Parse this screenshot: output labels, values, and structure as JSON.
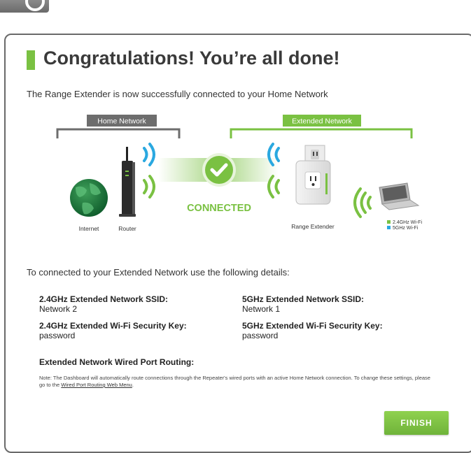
{
  "header": {
    "title": "Congratulations! You’re all done!",
    "subtitle": "The Range Extender is now successfully connected to your Home Network"
  },
  "diagram": {
    "home_network_label": "Home Network",
    "extended_network_label": "Extended Network",
    "internet_label": "Internet",
    "router_label": "Router",
    "status_label": "CONNECTED",
    "range_extender_label": "Range Extender",
    "legend": {
      "wifi_24_label": "2.4GHz Wi-Fi",
      "wifi_5_label": "5GHz Wi-Fi"
    },
    "colors": {
      "green": "#7ac142",
      "gray": "#6d6d6d",
      "wifi_24": "#7ac142",
      "wifi_5": "#2aa8e0"
    }
  },
  "details": {
    "intro": "To connected to your Extended Network use the following details:",
    "ssid_24_label": "2.4GHz Extended Network SSID:",
    "ssid_24_value": "Network 2",
    "ssid_5_label": "5GHz Extended Network SSID:",
    "ssid_5_value": "Network 1",
    "key_24_label": "2.4GHz Extended Wi-Fi Security Key:",
    "key_24_value": "password",
    "key_5_label": "5GHz Extended Wi-Fi Security Key:",
    "key_5_value": "password",
    "wired_routing_label": "Extended Network Wired Port Routing:",
    "note_text": "Note: The Dashboard will automatically route connections through the Repeater's wired ports with an active Home Network connection. To change these settings, please go to the ",
    "note_link": "Wired Port Routing Web Menu",
    "note_end": "."
  },
  "footer": {
    "finish_label": "FINISH"
  }
}
